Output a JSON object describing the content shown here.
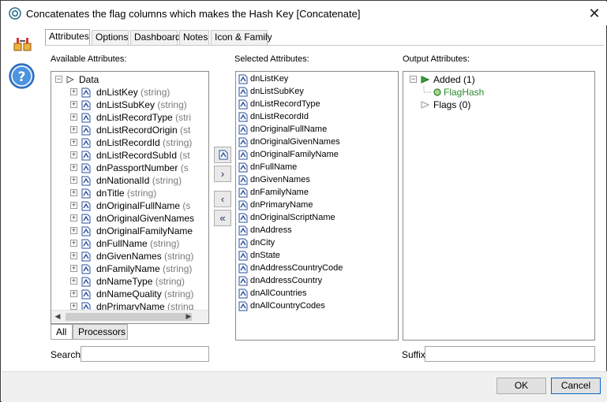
{
  "window": {
    "title": "Concatenates the flag columns which makes the Hash Key [Concatenate]",
    "close_label": "✕"
  },
  "tabs": [
    {
      "label": "Attributes",
      "active": true
    },
    {
      "label": "Options"
    },
    {
      "label": "Dashboard"
    },
    {
      "label": "Notes"
    },
    {
      "label": "Icon & Family"
    }
  ],
  "available": {
    "label": "Available Attributes:",
    "root_label": "Data",
    "items": [
      {
        "name": "dnListKey",
        "type": " (string)"
      },
      {
        "name": "dnListSubKey",
        "type": " (string)"
      },
      {
        "name": "dnListRecordType",
        "type": " (stri"
      },
      {
        "name": "dnListRecordOrigin",
        "type": " (st"
      },
      {
        "name": "dnListRecordId",
        "type": " (string)"
      },
      {
        "name": "dnListRecordSubId",
        "type": " (st"
      },
      {
        "name": "dnPassportNumber",
        "type": " (s"
      },
      {
        "name": "dnNationalId",
        "type": " (string)"
      },
      {
        "name": "dnTitle",
        "type": " (string)"
      },
      {
        "name": "dnOriginalFullName",
        "type": " (s"
      },
      {
        "name": "dnOriginalGivenNames",
        "type": ""
      },
      {
        "name": "dnOriginalFamilyName",
        "type": ""
      },
      {
        "name": "dnFullName",
        "type": " (string)"
      },
      {
        "name": "dnGivenNames",
        "type": " (string)"
      },
      {
        "name": "dnFamilyName",
        "type": " (string)"
      },
      {
        "name": "dnNameType",
        "type": " (string)"
      },
      {
        "name": "dnNameQuality",
        "type": " (string)"
      },
      {
        "name": "dnPrimaryName",
        "type": " (string"
      }
    ],
    "bottom_tabs": {
      "all": "All",
      "processors": "Processors"
    },
    "search_label": "Search",
    "search_value": ""
  },
  "selected": {
    "label": "Selected Attributes:",
    "items": [
      "dnListKey",
      "dnListSubKey",
      "dnListRecordType",
      "dnListRecordId",
      "dnOriginalFullName",
      "dnOriginalGivenNames",
      "dnOriginalFamilyName",
      "dnFullName",
      "dnGivenNames",
      "dnFamilyName",
      "dnPrimaryName",
      "dnOriginalScriptName",
      "dnAddress",
      "dnCity",
      "dnState",
      "dnAddressCountryCode",
      "dnAddressCountry",
      "dnAllCountries",
      "dnAllCountryCodes"
    ]
  },
  "middle_buttons": {
    "add": "›",
    "remove": "‹",
    "remove_all": "«"
  },
  "output": {
    "label": "Output Attributes:",
    "added_label": "Added (1)",
    "added_child": "FlagHash",
    "flags_label": "Flags (0)",
    "suffix_label": "Suffix",
    "suffix_value": ""
  },
  "footer": {
    "ok_label": "OK",
    "cancel_label": "Cancel"
  },
  "colors": {
    "accent_green": "#2e8b2e",
    "attr_icon_blue": "#2a4f9e",
    "type_gray": "#7a7a7a"
  }
}
